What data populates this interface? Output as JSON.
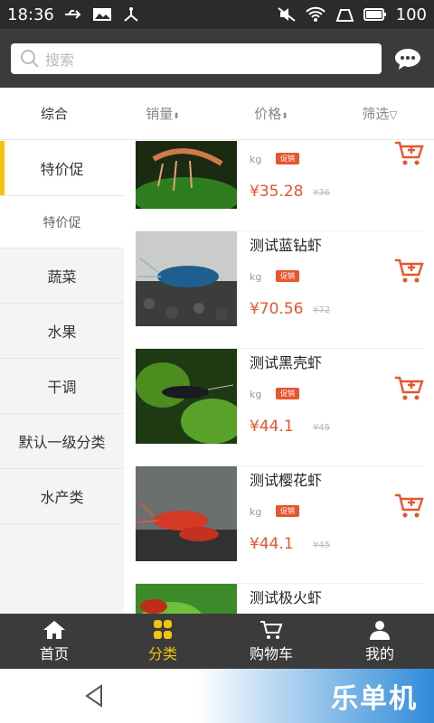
{
  "status_bar": {
    "time": "18:36",
    "battery": "100"
  },
  "search": {
    "placeholder": "搜索"
  },
  "sort_tabs": [
    {
      "label": "综合"
    },
    {
      "label": "销量"
    },
    {
      "label": "价格"
    },
    {
      "label": "筛选"
    }
  ],
  "sidebar": {
    "items": [
      {
        "label": "特价促"
      },
      {
        "label": "特价促"
      },
      {
        "label": "蔬菜"
      },
      {
        "label": "水果"
      },
      {
        "label": "干调"
      },
      {
        "label": "默认一级分类"
      },
      {
        "label": "水产类"
      }
    ]
  },
  "products": [
    {
      "name": "",
      "unit": "kg",
      "badge": "促销",
      "price": "¥35.28",
      "old_price": "¥36"
    },
    {
      "name": "测试蓝钻虾",
      "unit": "kg",
      "badge": "促销",
      "price": "¥70.56",
      "old_price": "¥72"
    },
    {
      "name": "测试黑壳虾",
      "unit": "kg",
      "badge": "促销",
      "price": "¥44.1",
      "old_price": "¥45"
    },
    {
      "name": "测试樱花虾",
      "unit": "kg",
      "badge": "促销",
      "price": "¥44.1",
      "old_price": "¥45"
    },
    {
      "name": "测试极火虾",
      "unit": "",
      "badge": "",
      "price": "",
      "old_price": ""
    }
  ],
  "tabbar": {
    "items": [
      {
        "label": "首页"
      },
      {
        "label": "分类"
      },
      {
        "label": "购物车"
      },
      {
        "label": "我的"
      }
    ]
  },
  "nav": {
    "brand": "乐单机"
  },
  "colors": {
    "accent": "#f1c40f",
    "price": "#e8552e",
    "header_bg": "#3b3b3b"
  }
}
